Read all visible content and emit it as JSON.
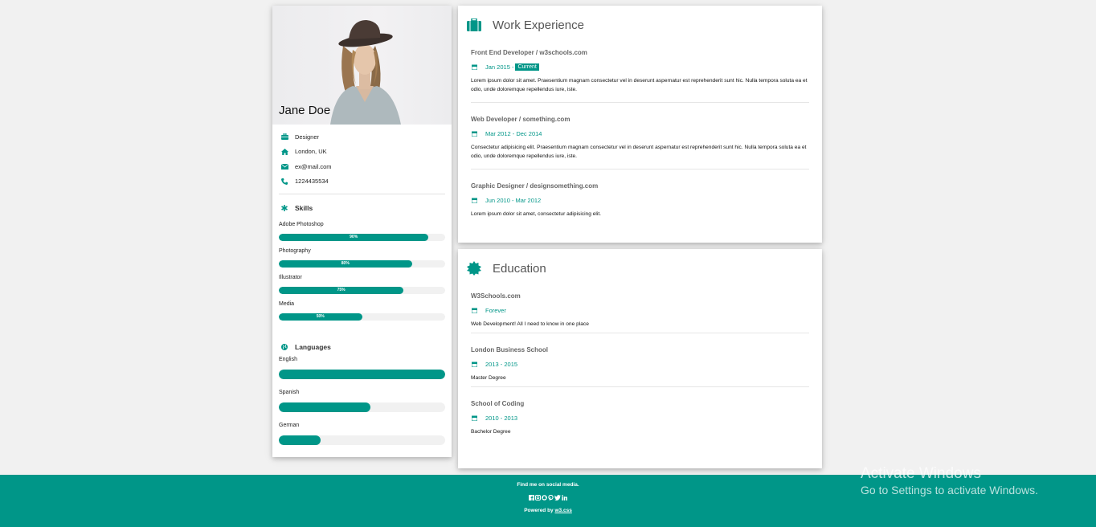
{
  "profile": {
    "name": "Jane Doe",
    "job": "Designer",
    "location": "London, UK",
    "email": "ex@mail.com",
    "phone": "1224435534"
  },
  "skills": {
    "title": "Skills",
    "items": [
      {
        "label": "Adobe Photoshop",
        "value": "90%",
        "percent": 90
      },
      {
        "label": "Photography",
        "value": "80%",
        "percent": 80
      },
      {
        "label": "Illustrator",
        "value": "75%",
        "percent": 75
      },
      {
        "label": "Media",
        "value": "50%",
        "percent": 50
      }
    ]
  },
  "languages": {
    "title": "Languages",
    "items": [
      {
        "label": "English",
        "percent": 100
      },
      {
        "label": "Spanish",
        "percent": 55
      },
      {
        "label": "German",
        "percent": 25
      }
    ]
  },
  "work": {
    "title": "Work Experience",
    "entries": [
      {
        "title": "Front End Developer / w3schools.com",
        "date": "Jan 2015 -",
        "tag": "Current",
        "desc": "Lorem ipsum dolor sit amet. Praesentium magnam consectetur vel in deserunt aspernatur est reprehenderit sunt hic. Nulla tempora soluta ea et odio, unde doloremque repellendus iure, iste."
      },
      {
        "title": "Web Developer / something.com",
        "date": "Mar 2012 - Dec 2014",
        "tag": "",
        "desc": "Consectetur adipisicing elit. Praesentium magnam consectetur vel in deserunt aspernatur est reprehenderit sunt hic. Nulla tempora soluta ea et odio, unde doloremque repellendus iure, iste."
      },
      {
        "title": "Graphic Designer / designsomething.com",
        "date": "Jun 2010 - Mar 2012",
        "tag": "",
        "desc": "Lorem ipsum dolor sit amet, consectetur adipisicing elit."
      }
    ]
  },
  "education": {
    "title": "Education",
    "entries": [
      {
        "title": "W3Schools.com",
        "date": "Forever",
        "desc": "Web Development! All I need to know in one place"
      },
      {
        "title": "London Business School",
        "date": "2013 - 2015",
        "desc": "Master Degree"
      },
      {
        "title": "School of Coding",
        "date": "2010 - 2013",
        "desc": "Bachelor Degree"
      }
    ]
  },
  "footer": {
    "find": "Find me on social media.",
    "powered_prefix": "Powered by",
    "powered_link": "w3.css",
    "social_icons": [
      "facebook-icon",
      "instagram-icon",
      "snapchat-icon",
      "pinterest-icon",
      "twitter-icon",
      "linkedin-icon"
    ]
  },
  "watermark": {
    "line1": "Activate Windows",
    "line2": "Go to Settings to activate Windows."
  },
  "colors": {
    "accent": "#009688",
    "background": "#f1f1f1"
  }
}
